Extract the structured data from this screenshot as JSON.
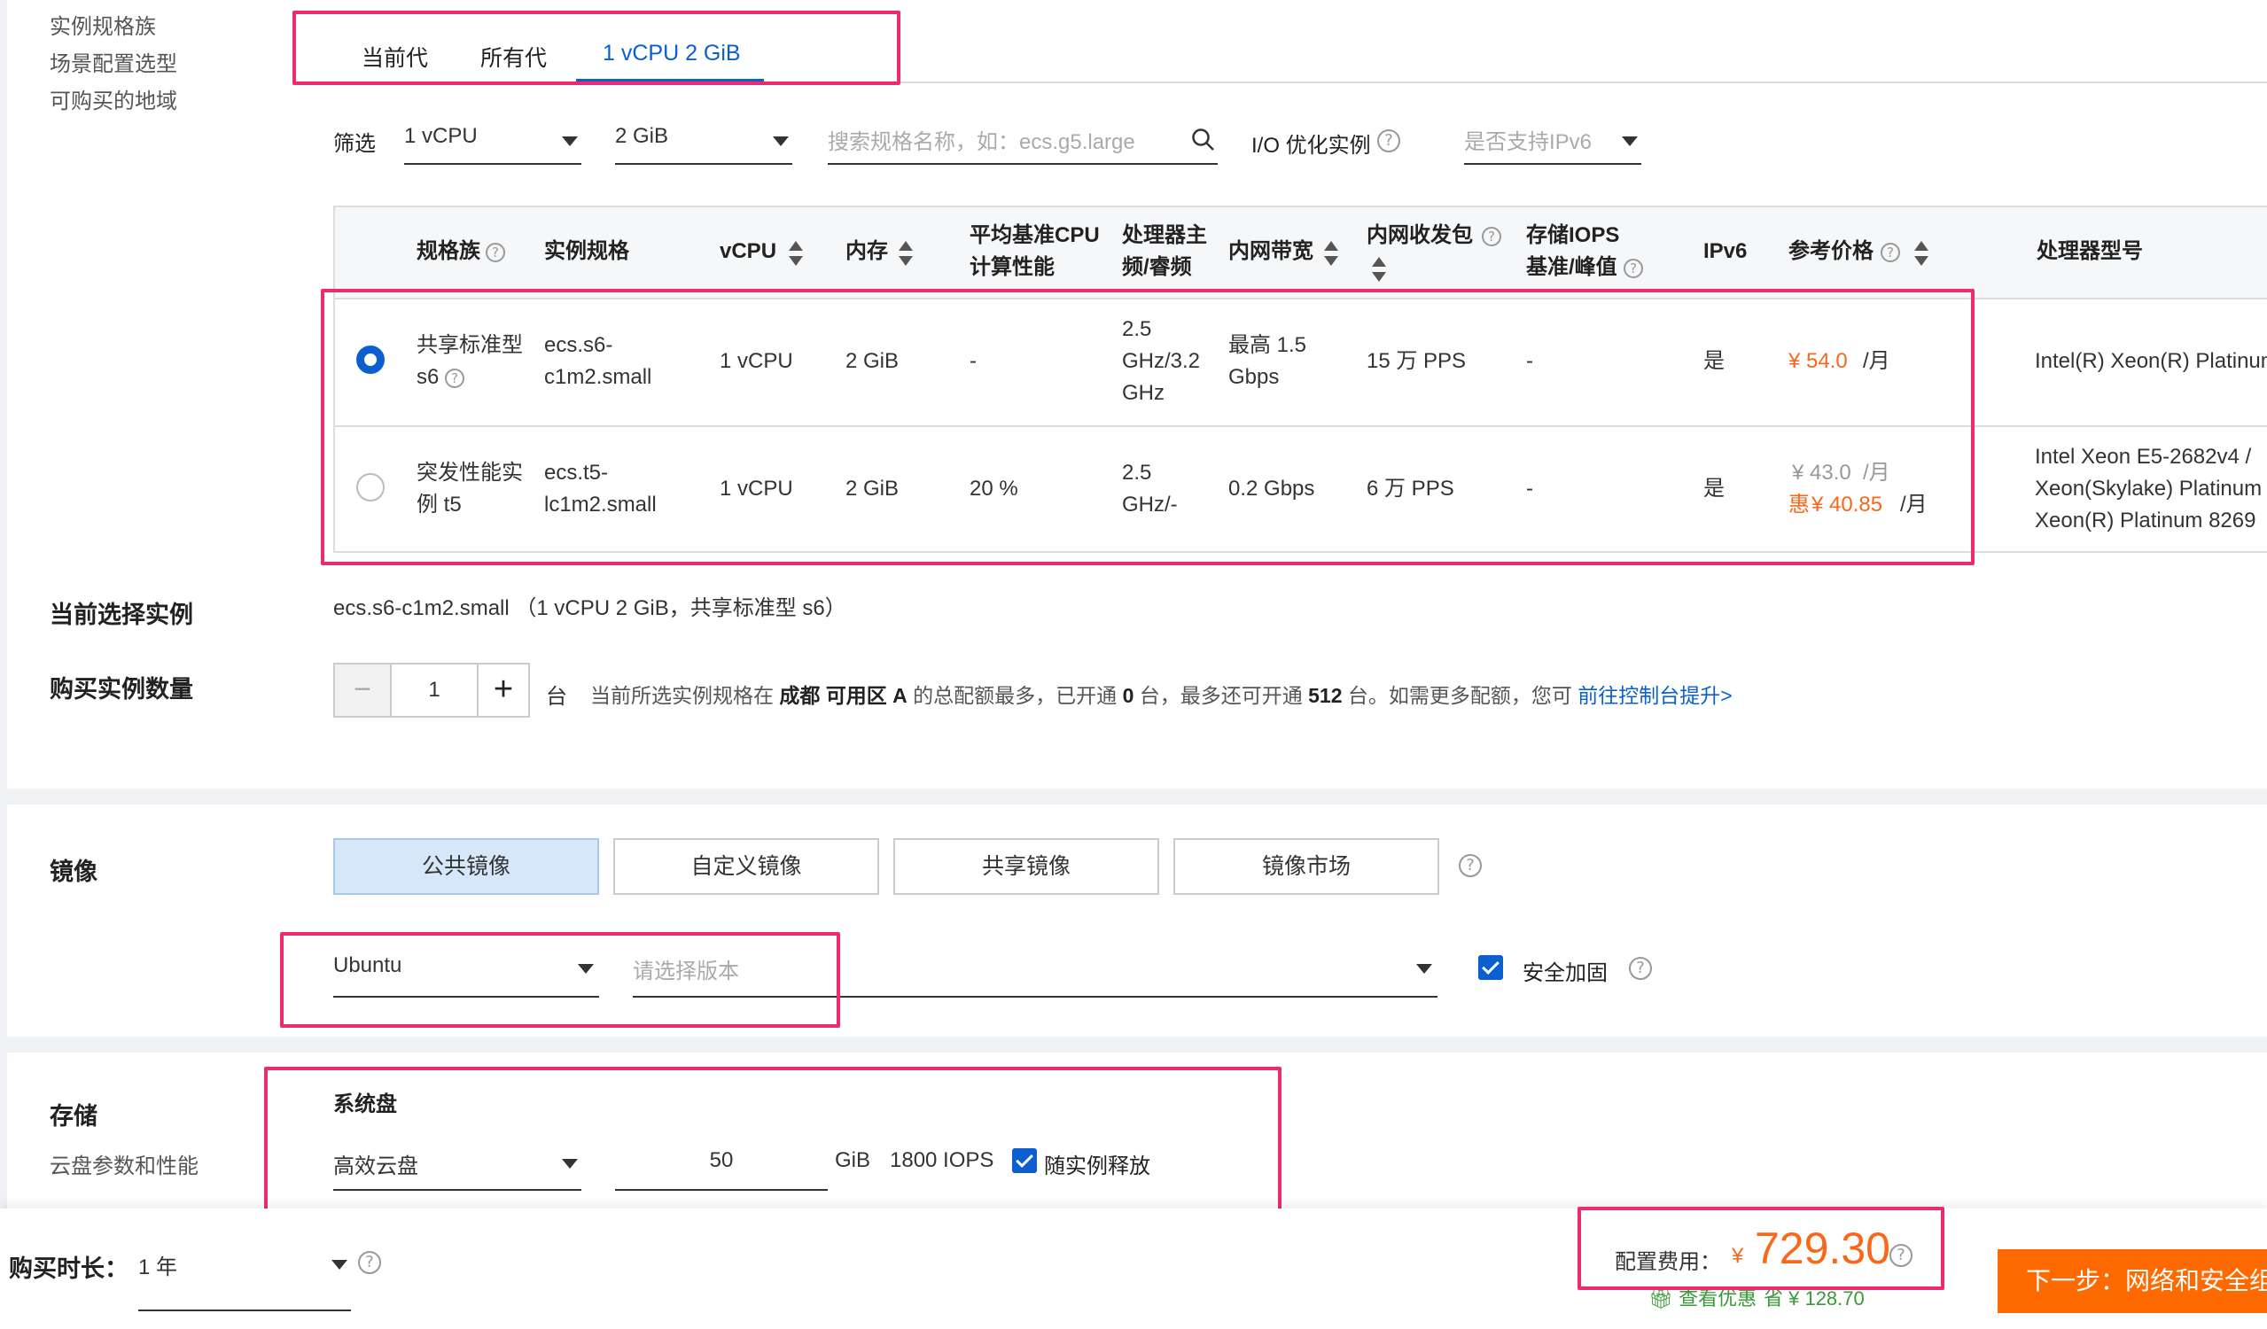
{
  "sidebar": {
    "items": [
      "实例规格族",
      "场景配置选型",
      "可购买的地域"
    ]
  },
  "tabs": [
    {
      "label": "当前代",
      "active": false
    },
    {
      "label": "所有代",
      "active": false
    },
    {
      "label": "1 vCPU 2 GiB",
      "active": true
    }
  ],
  "filter": {
    "label": "筛选",
    "vcpu": "1 vCPU",
    "memory": "2 GiB",
    "search_placeholder": "搜索规格名称，如：ecs.g5.large",
    "io_label": "I/O 优化实例",
    "ipv6_placeholder": "是否支持IPv6"
  },
  "table": {
    "headers": {
      "family": "规格族",
      "spec": "实例规格",
      "vcpu": "vCPU",
      "memory": "内存",
      "baseline_1": "平均基准CPU",
      "baseline_2": "计算性能",
      "freq_1": "处理器主",
      "freq_2": "频/睿频",
      "bandwidth": "内网带宽",
      "pps_1": "内网收发包",
      "iops_1": "存储IOPS",
      "iops_2": "基准/峰值",
      "ipv6": "IPv6",
      "price": "参考价格",
      "cpu_model": "处理器型号"
    },
    "rows": [
      {
        "selected": true,
        "family_1": "共享标准型",
        "family_2": "s6",
        "spec_1": "ecs.s6-",
        "spec_2": "c1m2.small",
        "vcpu": "1 vCPU",
        "memory": "2 GiB",
        "baseline": "-",
        "freq_1": "2.5",
        "freq_2": "GHz/3.2",
        "freq_3": "GHz",
        "bandwidth_1": "最高 1.5",
        "bandwidth_2": "Gbps",
        "pps": "15 万 PPS",
        "iops": "-",
        "ipv6": "是",
        "price": "¥ 54.0",
        "price_unit": "/月",
        "cpu_model": "Intel(R) Xeon(R) Platinum"
      },
      {
        "selected": false,
        "family_1": "突发性能实",
        "family_2": "例 t5",
        "spec_1": "ecs.t5-",
        "spec_2": "lc1m2.small",
        "vcpu": "1 vCPU",
        "memory": "2 GiB",
        "baseline": "20 %",
        "freq_1": "2.5",
        "freq_2": "GHz/-",
        "bandwidth": "0.2 Gbps",
        "pps": "6 万 PPS",
        "iops": "-",
        "ipv6": "是",
        "price_orig": "¥ 43.0",
        "price_orig_unit": "/月",
        "price_prefix": "惠",
        "price": "¥ 40.85",
        "price_unit": "/月",
        "cpu_model_1": "Intel Xeon E5-2682v4 /",
        "cpu_model_2": "Xeon(Skylake) Platinum",
        "cpu_model_3": "Xeon(R) Platinum 8269"
      }
    ]
  },
  "current": {
    "label": "当前选择实例",
    "value": "ecs.s6-c1m2.small （1 vCPU 2 GiB，共享标准型 s6）"
  },
  "quantity": {
    "label": "购买实例数量",
    "minus": "−",
    "value": "1",
    "plus": "+",
    "unit": "台",
    "note_1": "当前所选实例规格在",
    "region": "成都 可用区 A",
    "note_2": "的总配额最多，已开通",
    "opened": "0",
    "note_3": "台，最多还可开通",
    "remaining": "512",
    "note_4": "台。如需更多配额，您可",
    "link": "前往控制台提升>"
  },
  "image": {
    "title": "镜像",
    "tabs": [
      "公共镜像",
      "自定义镜像",
      "共享镜像",
      "镜像市场"
    ],
    "os": "Ubuntu",
    "version_placeholder": "请选择版本",
    "security_label": "安全加固"
  },
  "storage": {
    "title": "存储",
    "subtitle": "云盘参数和性能",
    "disk_title": "系统盘",
    "disk_type": "高效云盘",
    "size": "50",
    "size_unit": "GiB",
    "iops": "1800 IOPS",
    "release_label": "随实例释放"
  },
  "footer": {
    "duration_label": "购买时长：",
    "duration_value": "1 年",
    "cost_label": "配置费用：",
    "currency": "¥",
    "cost": "729.30",
    "discount_link": "查看优惠",
    "save_label": "省 ¥ 128.70",
    "next_button": "下一步：网络和安全组"
  }
}
